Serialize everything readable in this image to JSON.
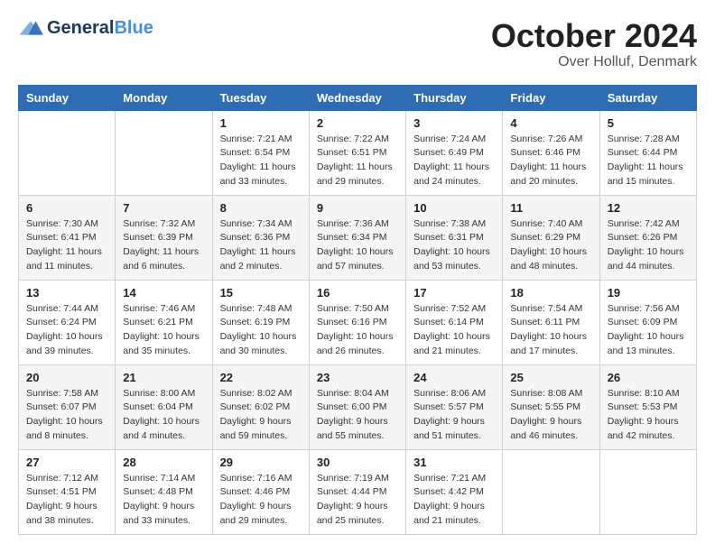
{
  "logo": {
    "name_part1": "General",
    "name_part2": "Blue"
  },
  "header": {
    "month": "October 2024",
    "location": "Over Holluf, Denmark"
  },
  "weekdays": [
    "Sunday",
    "Monday",
    "Tuesday",
    "Wednesday",
    "Thursday",
    "Friday",
    "Saturday"
  ],
  "weeks": [
    [
      {
        "day": "",
        "sunrise": "",
        "sunset": "",
        "daylight": ""
      },
      {
        "day": "",
        "sunrise": "",
        "sunset": "",
        "daylight": ""
      },
      {
        "day": "1",
        "sunrise": "Sunrise: 7:21 AM",
        "sunset": "Sunset: 6:54 PM",
        "daylight": "Daylight: 11 hours and 33 minutes."
      },
      {
        "day": "2",
        "sunrise": "Sunrise: 7:22 AM",
        "sunset": "Sunset: 6:51 PM",
        "daylight": "Daylight: 11 hours and 29 minutes."
      },
      {
        "day": "3",
        "sunrise": "Sunrise: 7:24 AM",
        "sunset": "Sunset: 6:49 PM",
        "daylight": "Daylight: 11 hours and 24 minutes."
      },
      {
        "day": "4",
        "sunrise": "Sunrise: 7:26 AM",
        "sunset": "Sunset: 6:46 PM",
        "daylight": "Daylight: 11 hours and 20 minutes."
      },
      {
        "day": "5",
        "sunrise": "Sunrise: 7:28 AM",
        "sunset": "Sunset: 6:44 PM",
        "daylight": "Daylight: 11 hours and 15 minutes."
      }
    ],
    [
      {
        "day": "6",
        "sunrise": "Sunrise: 7:30 AM",
        "sunset": "Sunset: 6:41 PM",
        "daylight": "Daylight: 11 hours and 11 minutes."
      },
      {
        "day": "7",
        "sunrise": "Sunrise: 7:32 AM",
        "sunset": "Sunset: 6:39 PM",
        "daylight": "Daylight: 11 hours and 6 minutes."
      },
      {
        "day": "8",
        "sunrise": "Sunrise: 7:34 AM",
        "sunset": "Sunset: 6:36 PM",
        "daylight": "Daylight: 11 hours and 2 minutes."
      },
      {
        "day": "9",
        "sunrise": "Sunrise: 7:36 AM",
        "sunset": "Sunset: 6:34 PM",
        "daylight": "Daylight: 10 hours and 57 minutes."
      },
      {
        "day": "10",
        "sunrise": "Sunrise: 7:38 AM",
        "sunset": "Sunset: 6:31 PM",
        "daylight": "Daylight: 10 hours and 53 minutes."
      },
      {
        "day": "11",
        "sunrise": "Sunrise: 7:40 AM",
        "sunset": "Sunset: 6:29 PM",
        "daylight": "Daylight: 10 hours and 48 minutes."
      },
      {
        "day": "12",
        "sunrise": "Sunrise: 7:42 AM",
        "sunset": "Sunset: 6:26 PM",
        "daylight": "Daylight: 10 hours and 44 minutes."
      }
    ],
    [
      {
        "day": "13",
        "sunrise": "Sunrise: 7:44 AM",
        "sunset": "Sunset: 6:24 PM",
        "daylight": "Daylight: 10 hours and 39 minutes."
      },
      {
        "day": "14",
        "sunrise": "Sunrise: 7:46 AM",
        "sunset": "Sunset: 6:21 PM",
        "daylight": "Daylight: 10 hours and 35 minutes."
      },
      {
        "day": "15",
        "sunrise": "Sunrise: 7:48 AM",
        "sunset": "Sunset: 6:19 PM",
        "daylight": "Daylight: 10 hours and 30 minutes."
      },
      {
        "day": "16",
        "sunrise": "Sunrise: 7:50 AM",
        "sunset": "Sunset: 6:16 PM",
        "daylight": "Daylight: 10 hours and 26 minutes."
      },
      {
        "day": "17",
        "sunrise": "Sunrise: 7:52 AM",
        "sunset": "Sunset: 6:14 PM",
        "daylight": "Daylight: 10 hours and 21 minutes."
      },
      {
        "day": "18",
        "sunrise": "Sunrise: 7:54 AM",
        "sunset": "Sunset: 6:11 PM",
        "daylight": "Daylight: 10 hours and 17 minutes."
      },
      {
        "day": "19",
        "sunrise": "Sunrise: 7:56 AM",
        "sunset": "Sunset: 6:09 PM",
        "daylight": "Daylight: 10 hours and 13 minutes."
      }
    ],
    [
      {
        "day": "20",
        "sunrise": "Sunrise: 7:58 AM",
        "sunset": "Sunset: 6:07 PM",
        "daylight": "Daylight: 10 hours and 8 minutes."
      },
      {
        "day": "21",
        "sunrise": "Sunrise: 8:00 AM",
        "sunset": "Sunset: 6:04 PM",
        "daylight": "Daylight: 10 hours and 4 minutes."
      },
      {
        "day": "22",
        "sunrise": "Sunrise: 8:02 AM",
        "sunset": "Sunset: 6:02 PM",
        "daylight": "Daylight: 9 hours and 59 minutes."
      },
      {
        "day": "23",
        "sunrise": "Sunrise: 8:04 AM",
        "sunset": "Sunset: 6:00 PM",
        "daylight": "Daylight: 9 hours and 55 minutes."
      },
      {
        "day": "24",
        "sunrise": "Sunrise: 8:06 AM",
        "sunset": "Sunset: 5:57 PM",
        "daylight": "Daylight: 9 hours and 51 minutes."
      },
      {
        "day": "25",
        "sunrise": "Sunrise: 8:08 AM",
        "sunset": "Sunset: 5:55 PM",
        "daylight": "Daylight: 9 hours and 46 minutes."
      },
      {
        "day": "26",
        "sunrise": "Sunrise: 8:10 AM",
        "sunset": "Sunset: 5:53 PM",
        "daylight": "Daylight: 9 hours and 42 minutes."
      }
    ],
    [
      {
        "day": "27",
        "sunrise": "Sunrise: 7:12 AM",
        "sunset": "Sunset: 4:51 PM",
        "daylight": "Daylight: 9 hours and 38 minutes."
      },
      {
        "day": "28",
        "sunrise": "Sunrise: 7:14 AM",
        "sunset": "Sunset: 4:48 PM",
        "daylight": "Daylight: 9 hours and 33 minutes."
      },
      {
        "day": "29",
        "sunrise": "Sunrise: 7:16 AM",
        "sunset": "Sunset: 4:46 PM",
        "daylight": "Daylight: 9 hours and 29 minutes."
      },
      {
        "day": "30",
        "sunrise": "Sunrise: 7:19 AM",
        "sunset": "Sunset: 4:44 PM",
        "daylight": "Daylight: 9 hours and 25 minutes."
      },
      {
        "day": "31",
        "sunrise": "Sunrise: 7:21 AM",
        "sunset": "Sunset: 4:42 PM",
        "daylight": "Daylight: 9 hours and 21 minutes."
      },
      {
        "day": "",
        "sunrise": "",
        "sunset": "",
        "daylight": ""
      },
      {
        "day": "",
        "sunrise": "",
        "sunset": "",
        "daylight": ""
      }
    ]
  ]
}
